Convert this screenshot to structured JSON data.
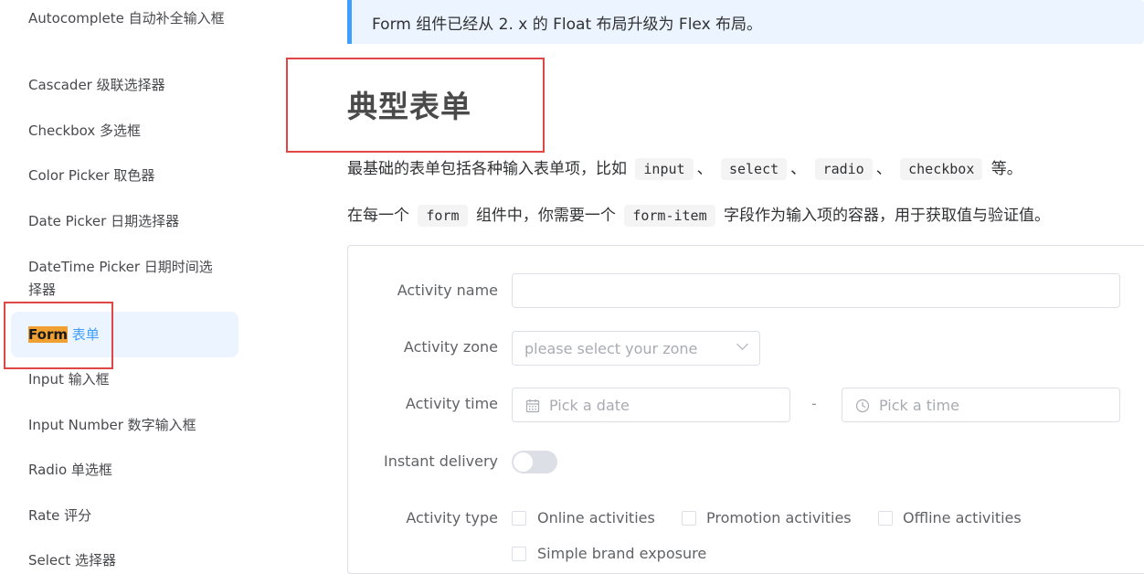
{
  "sidebar": {
    "items": [
      {
        "label": "Autocomplete 自动补全输入框"
      },
      {
        "label": "Cascader 级联选择器"
      },
      {
        "label": "Checkbox 多选框"
      },
      {
        "label": "Color Picker 取色器"
      },
      {
        "label": "Date Picker 日期选择器"
      },
      {
        "label": "DateTime Picker 日期时间选择器"
      },
      {
        "label_en": "Form",
        "label_zh": "表单",
        "active": true
      },
      {
        "label": "Input 输入框"
      },
      {
        "label": "Input Number 数字输入框"
      },
      {
        "label": "Radio 单选框"
      },
      {
        "label": "Rate 评分"
      },
      {
        "label": "Select 选择器"
      }
    ]
  },
  "tip": {
    "text": "Form 组件已经从 2. x 的 Float 布局升级为 Flex 布局。"
  },
  "page": {
    "title": "典型表单",
    "intro": {
      "prefix": "最基础的表单包括各种输入表单项，比如",
      "codes": [
        "input",
        "select",
        "radio",
        "checkbox"
      ],
      "sep": "、",
      "suffix": "等。"
    },
    "intro2": {
      "prefix": "在每一个",
      "code1": "form",
      "middle": "组件中，你需要一个",
      "code2": "form-item",
      "suffix": "字段作为输入项的容器，用于获取值与验证值。"
    }
  },
  "form": {
    "name_label": "Activity name",
    "name_value": "",
    "zone_label": "Activity zone",
    "zone_placeholder": "please select your zone",
    "time_label": "Activity time",
    "date_placeholder": "Pick a date",
    "time_separator": "-",
    "time_placeholder": "Pick a time",
    "delivery_label": "Instant delivery",
    "delivery_on": false,
    "type_label": "Activity type",
    "types": [
      "Online activities",
      "Promotion activities",
      "Offline activities",
      "Simple brand exposure"
    ]
  },
  "colors": {
    "accent": "#409eff",
    "highlight": "#f0a030",
    "annotation": "#e04646"
  },
  "icons": [
    "chevron-down-icon",
    "calendar-icon",
    "clock-icon"
  ]
}
